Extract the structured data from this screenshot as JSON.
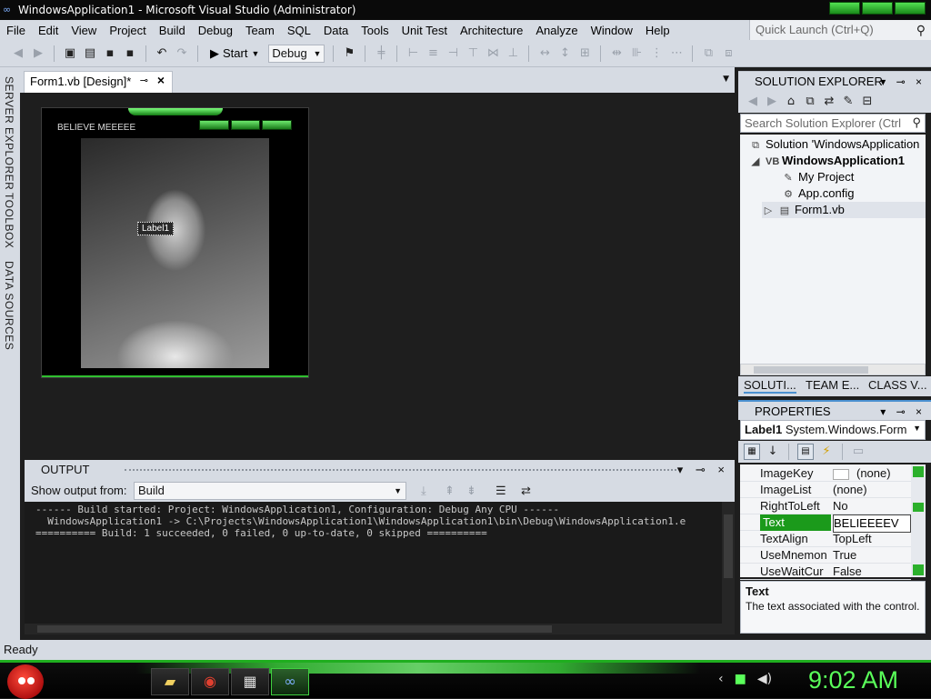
{
  "window": {
    "title": "WindowsApplication1 - Microsoft Visual Studio (Administrator)"
  },
  "menu": [
    "File",
    "Edit",
    "View",
    "Project",
    "Build",
    "Debug",
    "Team",
    "SQL",
    "Data",
    "Tools",
    "Unit Test",
    "Architecture",
    "Analyze",
    "Window",
    "Help"
  ],
  "quick_launch": {
    "placeholder": "Quick Launch (Ctrl+Q)"
  },
  "toolbar": {
    "start_label": "Start",
    "config_value": "Debug"
  },
  "side_tabs": [
    "SERVER EXPLORER",
    "TOOLBOX",
    "DATA SOURCES"
  ],
  "doc_tab": {
    "label": "Form1.vb [Design]*"
  },
  "form": {
    "title": "BELIEVE MEEEEE",
    "label1": "Label1"
  },
  "solution_explorer": {
    "title": "SOLUTION EXPLORER",
    "search_placeholder": "Search Solution Explorer (Ctrl",
    "tree": [
      {
        "label": "Solution 'WindowsApplication",
        "icon": "solution-icon"
      },
      {
        "label": "WindowsApplication1",
        "icon": "vb-project-icon",
        "bold": true
      },
      {
        "label": "My Project",
        "icon": "wrench-icon"
      },
      {
        "label": "App.config",
        "icon": "config-icon"
      },
      {
        "label": "Form1.vb",
        "icon": "form-icon"
      }
    ],
    "tabs": [
      "SOLUTI...",
      "TEAM E...",
      "CLASS V..."
    ]
  },
  "properties": {
    "title": "PROPERTIES",
    "object_name": "Label1",
    "object_type": "System.Windows.Form",
    "rows": [
      {
        "name": "ImageKey",
        "value": "(none)"
      },
      {
        "name": "ImageList",
        "value": "(none)"
      },
      {
        "name": "RightToLeft",
        "value": "No"
      },
      {
        "name": "Text",
        "value": "BELIEEEEV",
        "selected": true
      },
      {
        "name": "TextAlign",
        "value": "TopLeft"
      },
      {
        "name": "UseMnemon",
        "value": "True"
      },
      {
        "name": "UseWaitCur",
        "value": "False"
      }
    ],
    "desc_title": "Text",
    "desc_body": "The text associated with the control."
  },
  "output": {
    "title": "OUTPUT",
    "source_label": "Show output from:",
    "source_value": "Build",
    "lines": [
      "------ Build started: Project: WindowsApplication1, Configuration: Debug Any CPU ------",
      "  WindowsApplication1 -> C:\\Projects\\WindowsApplication1\\WindowsApplication1\\bin\\Debug\\WindowsApplication1.e",
      "========== Build: 1 succeeded, 0 failed, 0 up-to-date, 0 skipped =========="
    ]
  },
  "status": {
    "text": "Ready"
  },
  "taskbar": {
    "clock": "9:02 AM"
  },
  "colors": {
    "accent_green": "#1fae1f",
    "selection_green": "#1b9a1b",
    "clock_green": "#5aff5a"
  }
}
